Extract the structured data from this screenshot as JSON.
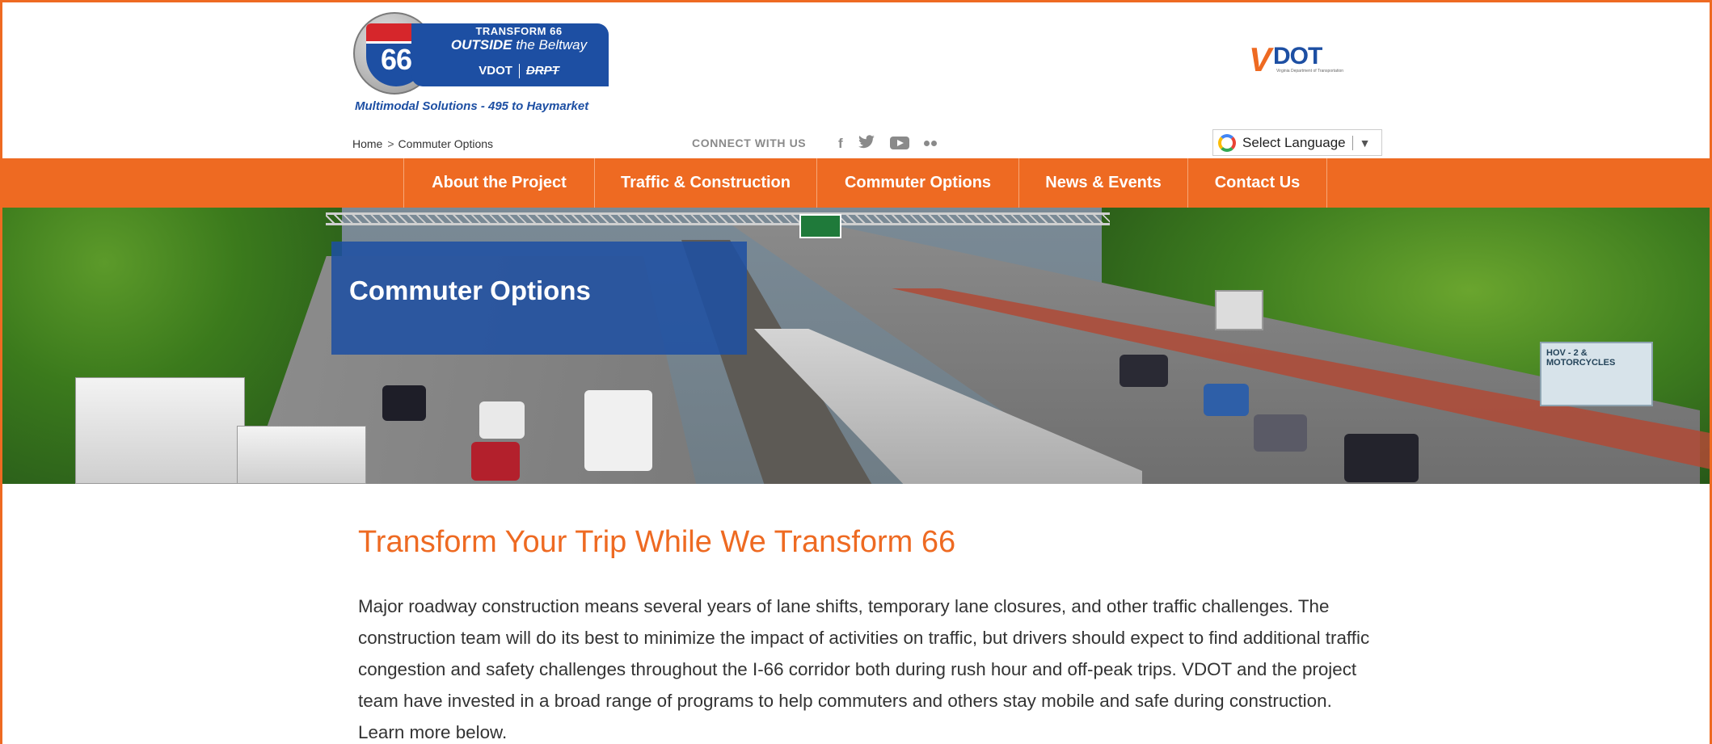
{
  "header": {
    "logo": {
      "shield_number": "66",
      "banner_line1": "TRANSFORM 66",
      "banner_line2_bold": "OUTSIDE",
      "banner_line2_rest": " the Beltway",
      "banner_logo_left": "VDOT",
      "banner_logo_right": "DRPT",
      "tagline": "Multimodal Solutions - 495 to Haymarket"
    },
    "vdot_logo": {
      "mark": "V",
      "text": "DOT",
      "subtext": "Virginia Department of Transportation"
    },
    "breadcrumb": {
      "home": "Home",
      "separator": ">",
      "current": "Commuter Options"
    },
    "connect_label": "CONNECT WITH US",
    "social_icons": [
      "facebook-icon",
      "twitter-icon",
      "youtube-icon",
      "flickr-icon"
    ],
    "social_glyphs": {
      "facebook": "f",
      "twitter": "🐦"
    },
    "language_select": {
      "label": "Select Language",
      "arrow": "▼"
    }
  },
  "nav": {
    "items": [
      {
        "label": "About the Project"
      },
      {
        "label": "Traffic & Construction"
      },
      {
        "label": "Commuter Options"
      },
      {
        "label": "News & Events"
      },
      {
        "label": "Contact Us"
      }
    ]
  },
  "hero": {
    "title": "Commuter Options",
    "sign_hov": "HOV - 2 & MOTORCYCLES"
  },
  "content": {
    "heading": "Transform Your Trip While We Transform 66",
    "body": "Major roadway construction means several years of lane shifts, temporary lane closures, and other traffic challenges. The construction team will do its best to minimize the impact of activities on traffic, but drivers should expect to find additional traffic congestion and safety challenges throughout the I-66 corridor both during rush hour and off-peak trips. VDOT and the project team have invested in a broad range of programs to help commuters and others stay mobile and safe during construction. Learn more below."
  },
  "colors": {
    "accent_orange": "#ee6a22",
    "brand_blue": "#1d4fa3"
  }
}
